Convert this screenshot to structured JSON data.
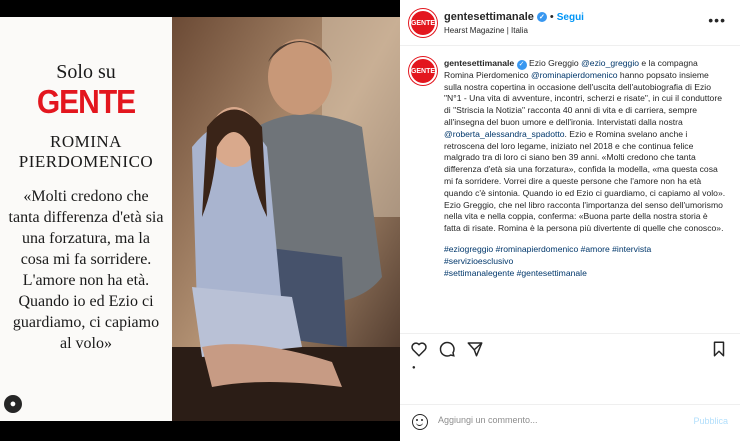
{
  "cover": {
    "line1": "Solo su",
    "logo": "GENTE",
    "name": "ROMINA PIERDOMENICO",
    "quote": "«Molti credono che tanta differenza d'età sia una forzatura, ma la cosa mi fa sorridere. L'amore non ha età. Quando io ed Ezio ci guardiamo, ci capiamo al volo»"
  },
  "header": {
    "avatar_text": "GENTE",
    "account": "gentesettimanale",
    "separator": "•",
    "follow": "Segui",
    "subtitle": "Hearst Magazine | Italia",
    "more_icon": "more-horizontal-icon"
  },
  "caption": {
    "account": "gentesettimanale",
    "p1": "Ezio Greggio ",
    "m1": "@ezio_greggio",
    "p2": " e la compagna Romina Pierdomenico ",
    "m2": "@rominapierdomenico",
    "p3": " hanno popsato insieme sulla nostra copertina in occasione dell'uscita dell'autobiografia di Ezio \"N°1 - Una vita di avventure, incontri, scherzi e risate\", in cui il conduttore di \"Striscia la Notizia\" racconta 40 anni di vita e di carriera, sempre all'insegna del buon umore e dell'ironia. Intervistati dalla nostra ",
    "m3": "@roberta_alessandra_spadotto",
    "p4": ". Ezio e Romina svelano anche i retroscena del loro legame, iniziato nel 2018 e che continua felice malgrado tra di loro ci siano ben 39 anni. «Molti credono che tanta differenza d'età sia una forzatura», confida la modella, «ma questa cosa mi fa sorridere. Vorrei dire a queste persone che l'amore non ha età quando c'è sintonia. Quando io ed Ezio ci guardiamo, ci capiamo al volo». Ezio Greggio, che nel libro racconta l'importanza del senso dell'umorismo nella vita e nella coppia, conferma: «Buona parte della nostra storia è fatta di risate. Romina è la persona più divertente di quelle che conosco».",
    "tags1": "#eziogreggio #rominapierdomenico #amore #intervista",
    "tags2": "#servizioesclusivo",
    "tags3": "#settimanalegente #gentesettimanale"
  },
  "actions": {
    "like_icon": "heart-icon",
    "comment_icon": "comment-icon",
    "share_icon": "share-icon",
    "save_icon": "bookmark-icon"
  },
  "comment": {
    "placeholder": "Aggiungi un commento...",
    "publish": "Pubblica"
  },
  "colors": {
    "brand_red": "#e3161e",
    "link_blue": "#0095f6",
    "mention_blue": "#00376b"
  }
}
